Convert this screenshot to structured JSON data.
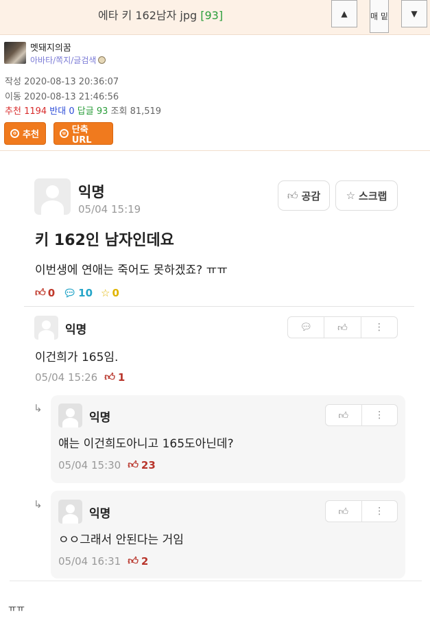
{
  "header": {
    "title": "에타 키 162남자 jpg",
    "count": "[93]",
    "up_icon": "triangle-up-icon",
    "mini_label": "매 밑",
    "down_icon": "triangle-down-icon"
  },
  "author": {
    "nickname": "멧돼지의꿈",
    "links": "아바타/쪽지/글검색",
    "created_label": "작성",
    "created": "2020-08-13 20:36:07",
    "moved_label": "이동",
    "moved": "2020-08-13 21:46:56",
    "rec_label": "추천",
    "rec": "1194",
    "opp_label": "반대",
    "opp": "0",
    "reply_label": "답글",
    "reply": "93",
    "view_label": "조회",
    "view": "81,519"
  },
  "buttons": {
    "recommend": "추천",
    "short_url": "단축URL"
  },
  "post": {
    "author": "익명",
    "date": "05/04 15:19",
    "empathy": "공감",
    "scrap": "스크랩",
    "title": "키 162인 남자인데요",
    "body": "이번생에 연애는 죽어도 못하겠죠? ㅠㅠ",
    "likes": "0",
    "comments": "10",
    "scraps": "0"
  },
  "comments": [
    {
      "author": "익명",
      "text": "이건희가 165임.",
      "date": "05/04 15:26",
      "likes": "1"
    },
    {
      "author": "익명",
      "text": "얘는 이건희도아니고 165도아닌데?",
      "date": "05/04 15:30",
      "likes": "23"
    },
    {
      "author": "익명",
      "text": "ㅇㅇ그래서 안된다는 거임",
      "date": "05/04 16:31",
      "likes": "2"
    }
  ],
  "footer": {
    "text": "ㅠㅠ"
  },
  "colors": {
    "accent_orange": "#f07a1e",
    "header_bg": "#fdf1e6",
    "like_red": "#b8342a",
    "comment_blue": "#25a5c8"
  }
}
